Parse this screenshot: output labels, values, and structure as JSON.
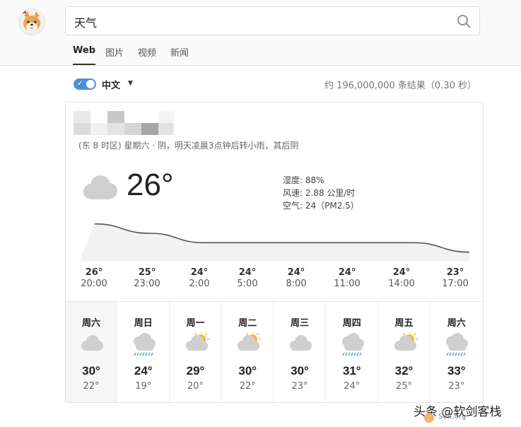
{
  "header": {
    "search": {
      "value": "天气",
      "placeholder": ""
    },
    "tabs": [
      {
        "label": "Web",
        "active": true
      },
      {
        "label": "图片",
        "active": false
      },
      {
        "label": "视频",
        "active": false
      },
      {
        "label": "新闻",
        "active": false
      }
    ]
  },
  "filters": {
    "language_label": "中文",
    "language_toggle_on": true,
    "result_count": "约 196,000,000 条结果（0.30 秒）"
  },
  "weather": {
    "datetime": "(东 8 时区) 星期六 · 阴，明天凌晨3点钟后转小雨，其后阴",
    "current_temp": "26°",
    "current_icon": "cloud-icon",
    "humidity": "湿度: 88%",
    "wind": "风速: 2.88 公里/时",
    "air": "空气: 24（PM2.5）",
    "hourly": [
      {
        "temp": "26°",
        "time": "20:00",
        "value": 26
      },
      {
        "temp": "25°",
        "time": "23:00",
        "value": 25
      },
      {
        "temp": "24°",
        "time": "2:00",
        "value": 24
      },
      {
        "temp": "24°",
        "time": "5:00",
        "value": 24
      },
      {
        "temp": "24°",
        "time": "8:00",
        "value": 24
      },
      {
        "temp": "24°",
        "time": "11:00",
        "value": 24
      },
      {
        "temp": "24°",
        "time": "14:00",
        "value": 24
      },
      {
        "temp": "23°",
        "time": "17:00",
        "value": 23
      }
    ],
    "daily": [
      {
        "day": "周六",
        "icon": "cloud-icon",
        "high": "30°",
        "low": "22°",
        "selected": true
      },
      {
        "day": "周日",
        "icon": "rain-icon",
        "high": "24°",
        "low": "19°",
        "selected": false
      },
      {
        "day": "周一",
        "icon": "partly-cloudy-icon",
        "high": "29°",
        "low": "20°",
        "selected": false
      },
      {
        "day": "周二",
        "icon": "partly-cloudy-icon",
        "high": "30°",
        "low": "22°",
        "selected": false
      },
      {
        "day": "周三",
        "icon": "cloud-icon",
        "high": "30°",
        "low": "23°",
        "selected": false
      },
      {
        "day": "周四",
        "icon": "rain-icon",
        "high": "31°",
        "low": "24°",
        "selected": false
      },
      {
        "day": "周五",
        "icon": "partly-cloudy-icon",
        "high": "32°",
        "low": "25°",
        "selected": false
      },
      {
        "day": "周六",
        "icon": "rain-icon",
        "high": "33°",
        "low": "23°",
        "selected": false
      }
    ]
  },
  "watermark": {
    "text": "头条 @软剑客栈",
    "site": "Soft.org"
  },
  "colors": {
    "accent": "#4a90d9",
    "cloud": "#cfcfcf",
    "sun": "#f5b731",
    "rain": "#5b9bd5",
    "curve_fill": "#f2f2f2",
    "curve_line": "#555555"
  }
}
